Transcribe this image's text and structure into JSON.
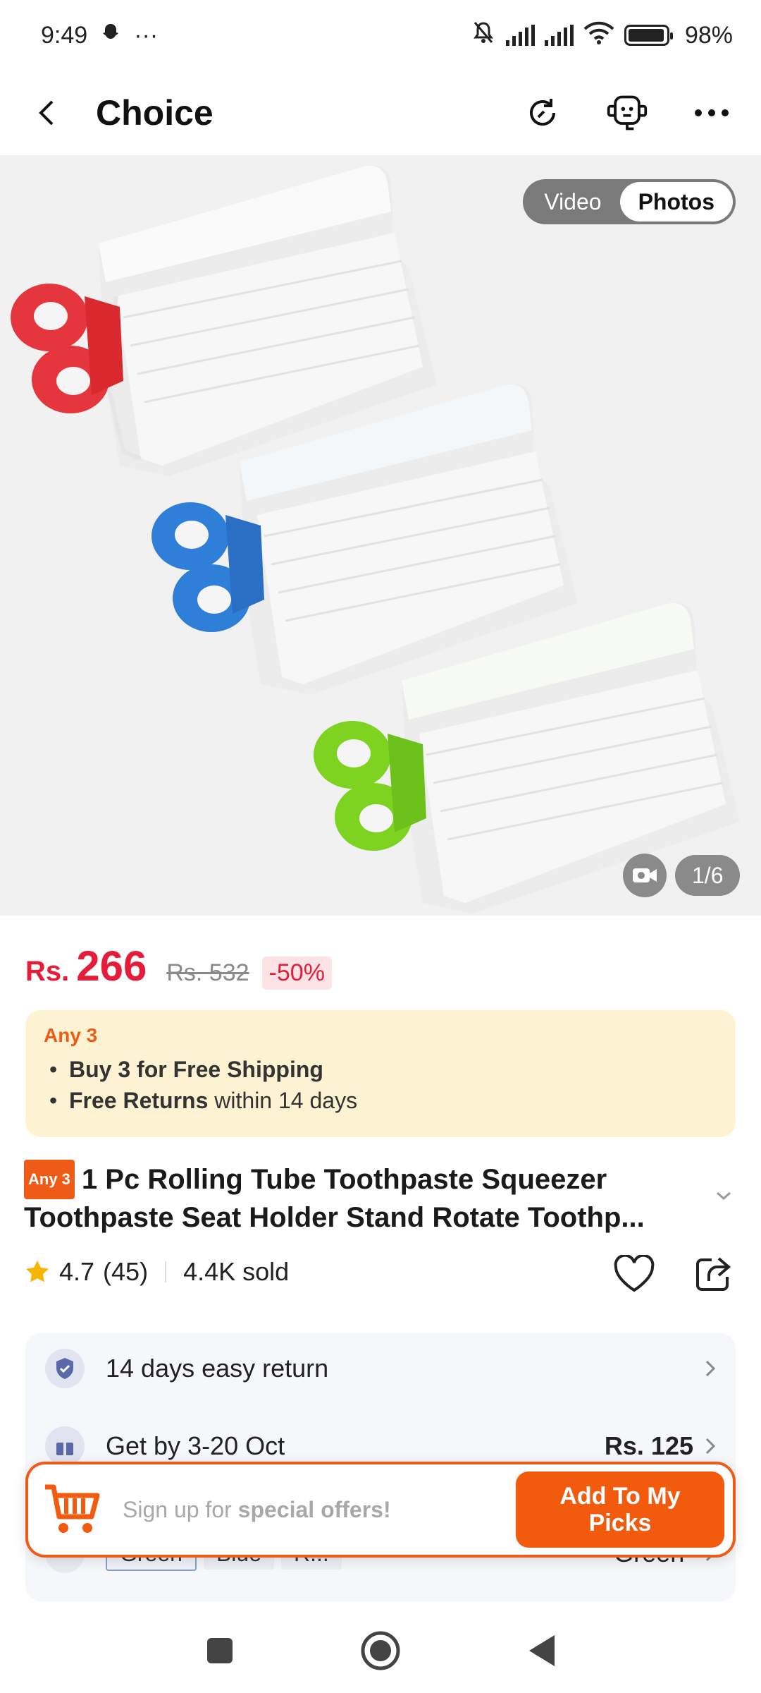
{
  "status_bar": {
    "time": "9:49",
    "more": "···",
    "battery": "98%"
  },
  "header": {
    "title": "Choice"
  },
  "gallery": {
    "tabs": [
      "Video",
      "Photos"
    ],
    "active_tab": "Photos",
    "counter": "1/6"
  },
  "price": {
    "currency": "Rs.",
    "current": "266",
    "original": "Rs. 532",
    "discount": "-50%"
  },
  "offer": {
    "tag": "Any 3",
    "line1_bold": "Buy 3 for  Free Shipping",
    "line2_bold": "Free Returns",
    "line2_rest": " within 14 days"
  },
  "product": {
    "tag": "Any 3",
    "title_line1": "1 Pc Rolling Tube Toothpaste Squeezer",
    "title_line2": "Toothpaste Seat Holder Stand Rotate Toothp..."
  },
  "rating": {
    "score": "4.7",
    "count": "(45)",
    "sold": "4.4K sold"
  },
  "info": {
    "returns": "14 days easy return",
    "delivery": "Get by 3-20 Oct",
    "shipping_fee": "Rs. 125",
    "variants": [
      "Green",
      "Blue",
      "R..."
    ],
    "selected_variant": "\"Green\""
  },
  "signup": {
    "text_prefix": "Sign up for ",
    "text_bold": "special offers!",
    "button": "Add To My Picks"
  },
  "colors": {
    "accent": "#f25a0e",
    "price": "#e51d3a",
    "offer_bg": "#fdf3d3"
  }
}
